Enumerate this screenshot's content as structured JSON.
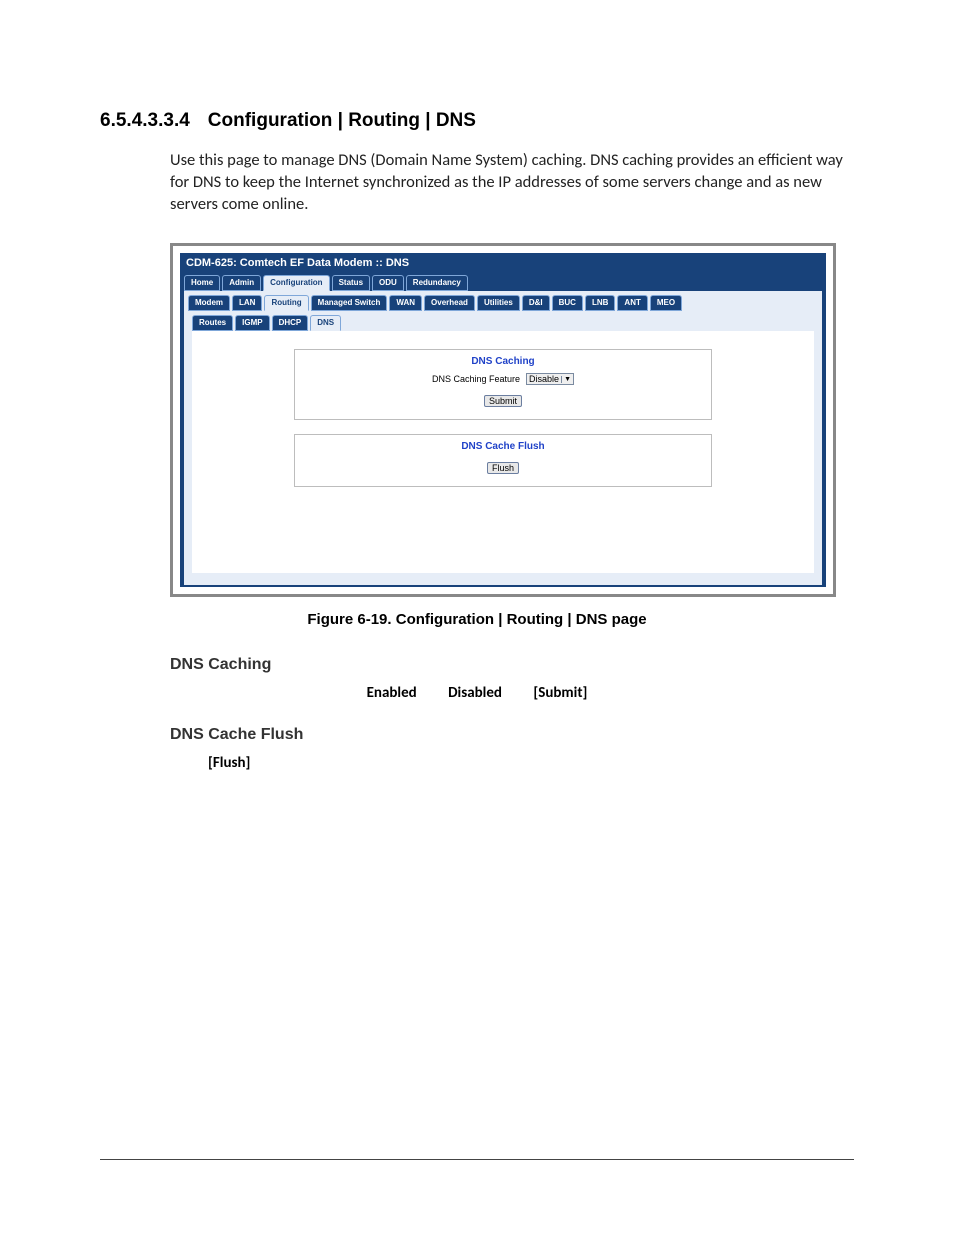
{
  "section": {
    "number": "6.5.4.3.3.4",
    "title": "Configuration | Routing | DNS"
  },
  "intro": "Use this page to manage DNS (Domain Name System) caching. DNS caching provides an efficient way for DNS to keep the Internet synchronized as the IP addresses of some servers change and as new servers come online.",
  "shot": {
    "titlebar": "CDM-625: Comtech EF Data Modem :: DNS",
    "tabs1": [
      "Home",
      "Admin",
      "Configuration",
      "Status",
      "ODU",
      "Redundancy"
    ],
    "tabs1_active": 2,
    "tabs2": [
      "Modem",
      "LAN",
      "Routing",
      "Managed Switch",
      "WAN",
      "Overhead",
      "Utilities",
      "D&I",
      "BUC",
      "LNB",
      "ANT",
      "MEO"
    ],
    "tabs2_active": 2,
    "tabs3": [
      "Routes",
      "IGMP",
      "DHCP",
      "DNS"
    ],
    "tabs3_active": 3,
    "panel1": {
      "legend": "DNS Caching",
      "label": "DNS Caching Feature",
      "value": "Disable",
      "button": "Submit"
    },
    "panel2": {
      "legend": "DNS Cache Flush",
      "button": "Flush"
    }
  },
  "caption": "Figure 6-19. Configuration | Routing | DNS page",
  "body": {
    "h1": "DNS Caching",
    "opts": {
      "a": "Enabled",
      "b": "Disabled",
      "c": "[Submit]"
    },
    "h2": "DNS Cache Flush",
    "flush": "[Flush]"
  }
}
